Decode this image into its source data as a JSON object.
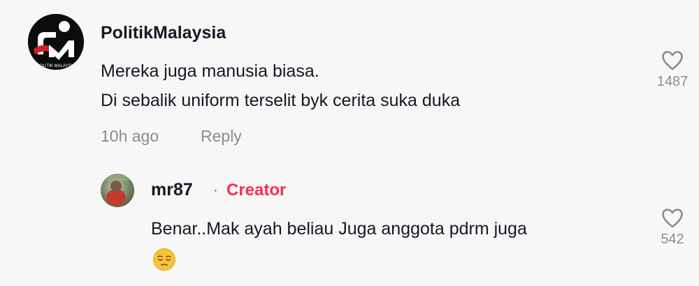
{
  "comment": {
    "username": "PolitikMalaysia",
    "lines": [
      "Mereka juga manusia biasa.",
      "Di sebalik uniform terselit byk cerita suka duka"
    ],
    "time": "10h ago",
    "reply_label": "Reply",
    "likes": "1487",
    "avatar": "politik-malaysia-logo"
  },
  "reply": {
    "username": "mr87",
    "separator": "·",
    "badge": "Creator",
    "text": "Benar..Mak ayah beliau Juga anggota pdrm juga",
    "emoji": "pensive-face",
    "likes": "542",
    "avatar": "user-photo"
  },
  "colors": {
    "background": "#f7f7f7",
    "text": "#161823",
    "muted": "#8a8b91",
    "creator": "#fe2c55"
  },
  "icons": {
    "like": "heart-outline-icon"
  }
}
